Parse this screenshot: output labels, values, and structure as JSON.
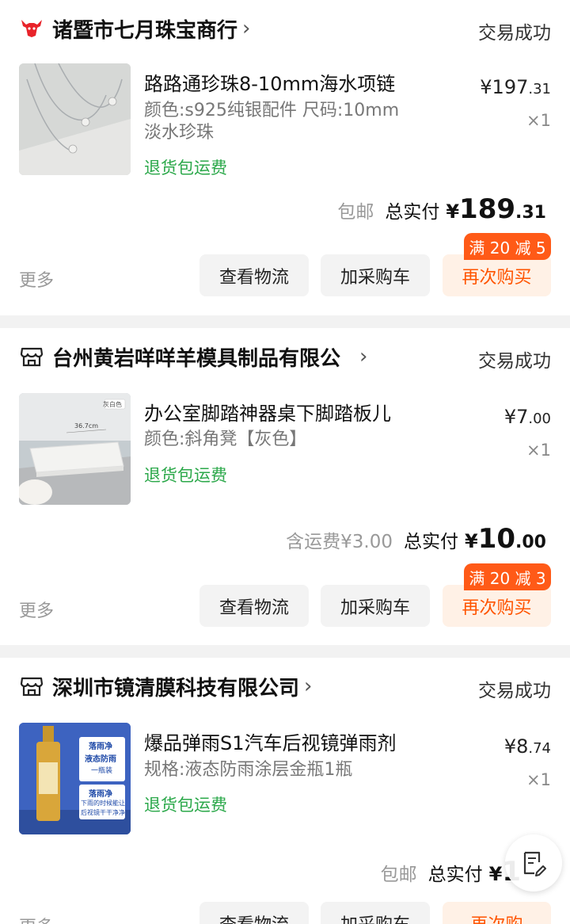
{
  "status_text": "交易成功",
  "actions": {
    "more": "更多",
    "logistics": "查看物流",
    "add_cart": "加采购车",
    "rebuy": "再次购买",
    "rebuy_partial": "再次购",
    "logistics_partial": "查看物流"
  },
  "orders": [
    {
      "shop": "诸暨市七月珠宝商行",
      "shop_arrow": "›",
      "product_title": "路路通珍珠8-10mm海水项链",
      "spec_line1": "颜色:s925纯银配件 尺码:10mm",
      "spec_line2": "淡水珍珠",
      "return_tag": "退货包运费",
      "price_int": "¥197",
      "price_dec": ".31",
      "qty": "×1",
      "freight": "包邮",
      "total_label": "总实付",
      "total_cur": "¥",
      "total_int": "189",
      "total_dec": ".31",
      "promo": "满 20 减 5"
    },
    {
      "shop": "台州黄岩咩咩羊模具制品有限公",
      "shop_arrow": "›",
      "product_title": "办公室脚踏神器桌下脚踏板儿",
      "spec_line1": "颜色:斜角凳【灰色】",
      "return_tag": "退货包运费",
      "price_int": "¥7",
      "price_dec": ".00",
      "qty": "×1",
      "freight": "含运费¥3.00",
      "total_label": "总实付",
      "total_cur": "¥",
      "total_int": "10",
      "total_dec": ".00",
      "promo": "满 20 减 3",
      "thumb_label": "灰白色",
      "thumb_dims": "36.7cm"
    },
    {
      "shop": "深圳市镜清膜科技有限公司",
      "shop_arrow": "›",
      "product_title": "爆品弹雨S1汽车后视镜弹雨剂",
      "spec_line1": "规格:液态防雨涂层金瓶1瓶",
      "return_tag": "退货包运费",
      "price_int": "¥8",
      "price_dec": ".74",
      "qty": "×1",
      "freight": "包邮",
      "total_label": "总实付",
      "total_cur": "¥",
      "total_int": "1",
      "thumb_text1": "落雨净",
      "thumb_text2": "液态防雨",
      "thumb_text3": "一瓶装",
      "thumb_text4": "落雨净",
      "thumb_text5": "下雨的时候能让",
      "thumb_text6": "后视镜干干净净"
    }
  ],
  "colors": {
    "accent": "#ff5400",
    "promo_bg": "#ff5a17",
    "green": "#2ba84a",
    "logo_red": "#e8232a"
  },
  "icons": {
    "shop1": "bull-logo-icon",
    "shop2": "store-icon",
    "shop3": "store-icon",
    "float": "edit-note-icon"
  }
}
